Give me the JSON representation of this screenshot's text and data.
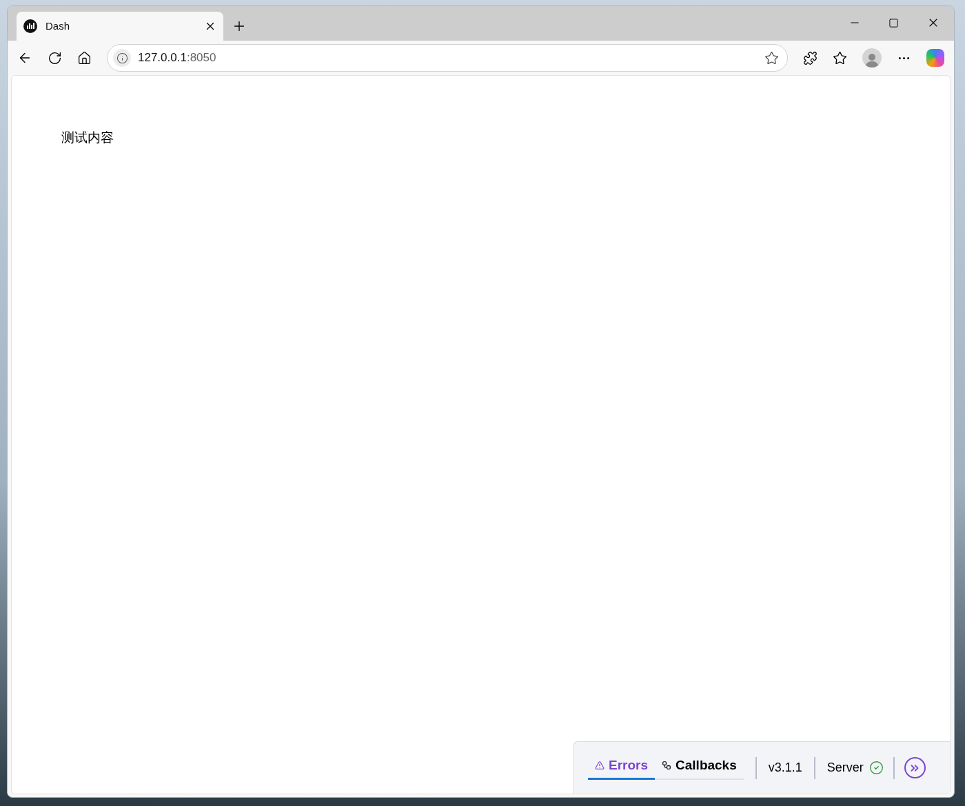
{
  "browser": {
    "tab": {
      "title": "Dash"
    },
    "address": {
      "host": "127.0.0.1",
      "port": ":8050"
    }
  },
  "page": {
    "text": "测试内容"
  },
  "devtools": {
    "tabs": [
      {
        "label": "Errors",
        "selected": true
      },
      {
        "label": "Callbacks",
        "selected": false
      }
    ],
    "version": "v3.1.1",
    "server": {
      "label": "Server",
      "ok": true
    }
  }
}
